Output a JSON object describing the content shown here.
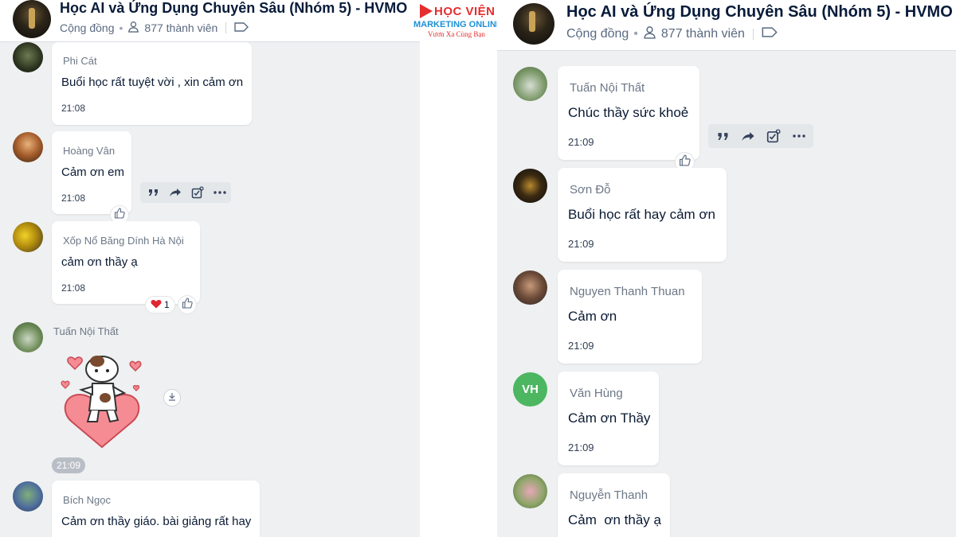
{
  "group": {
    "title": "Học AI và Ứng Dụng Chuyên Sâu (Nhóm 5) - HVMO",
    "type": "Cộng đồng",
    "members": "877 thành viên",
    "icons": [
      "group-avatar",
      "person-icon",
      "tag-icon"
    ]
  },
  "brand": {
    "line1": "HỌC VIỆN",
    "line2": "MARKETING ONLINE",
    "line3": "Vươn Xa Cùng Bạn",
    "colors": {
      "red": "#e52d2d",
      "blue": "#1e8fd6"
    }
  },
  "left_messages": [
    {
      "sender": "Phi Cát",
      "text": "Buổi học rất tuyệt vời , xin cảm ơn",
      "time": "21:08"
    },
    {
      "sender": "Hoàng Vân",
      "text": "Cảm ơn em",
      "time": "21:08"
    },
    {
      "sender": "Xốp Nổ Băng Dính Hà Nội",
      "text": "cảm ơn thầy ạ",
      "time": "21:08",
      "reaction_count": "1"
    },
    {
      "sender": "Tuấn Nội Thất",
      "sticker": "heart-sticker",
      "time": "21:09"
    },
    {
      "sender": "Bích Ngọc",
      "text": "Cảm ơn thầy giáo. bài giảng rất hay"
    }
  ],
  "right_messages": [
    {
      "sender": "Tuấn Nội Thất",
      "text": "Chúc thầy sức khoẻ",
      "time": "21:09"
    },
    {
      "sender": "Sơn Đỗ",
      "text": "Buổi học rất hay cảm ơn",
      "time": "21:09"
    },
    {
      "sender": "Nguyen Thanh Thuan",
      "text": "Cảm ơn",
      "time": "21:09"
    },
    {
      "sender": "Văn Hùng",
      "initials": "VH",
      "text": "Cảm ơn Thầy",
      "time": "21:09"
    },
    {
      "sender": "Nguyễn Thanh",
      "text": "Cảm  ơn thầy ạ"
    }
  ],
  "toolbar_icons": [
    "quote-icon",
    "share-icon",
    "task-icon",
    "more-icon"
  ],
  "colors": {
    "background": "#eef0f1",
    "bubble": "#ffffff",
    "heart": "#e0262f",
    "initials_avatar": "#4cb660"
  }
}
